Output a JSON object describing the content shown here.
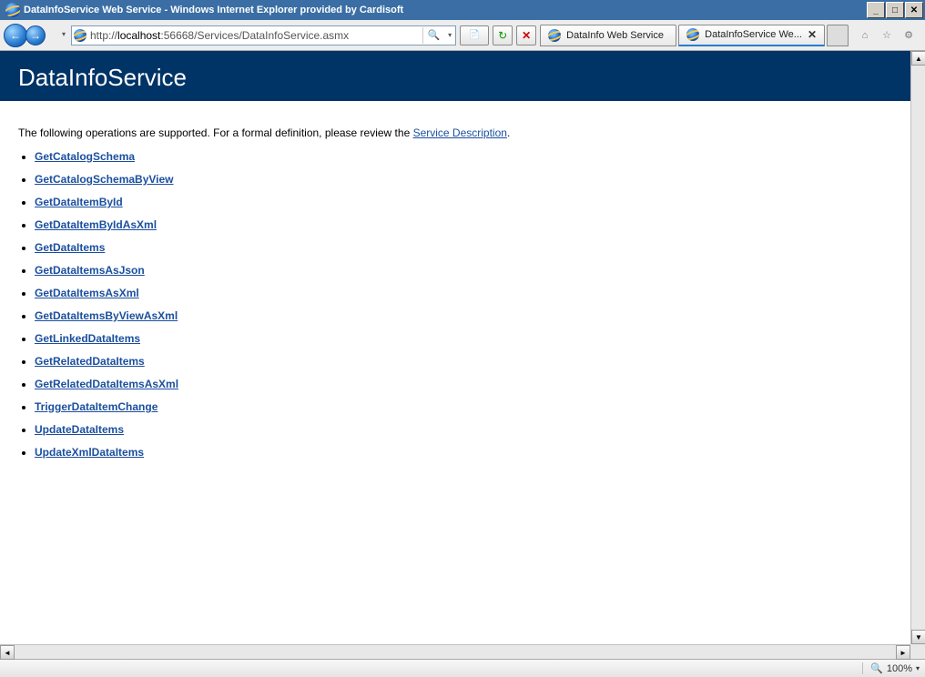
{
  "window": {
    "title": "DataInfoService Web Service - Windows Internet Explorer provided by Cardisoft"
  },
  "address": {
    "prefix": "http://",
    "host": "localhost",
    "port_path": ":56668/Services/DataInfoService.asmx"
  },
  "tabs": [
    {
      "label": "DataInfo Web Service",
      "active": false,
      "closeable": false
    },
    {
      "label": "DataInfoService We...",
      "active": true,
      "closeable": true
    }
  ],
  "page": {
    "heading": "DataInfoService",
    "intro_pre": "The following operations are supported. For a formal definition, please review the ",
    "intro_link": "Service Description",
    "intro_post": ".",
    "operations": [
      "GetCatalogSchema",
      "GetCatalogSchemaByView",
      "GetDataItemById",
      "GetDataItemByIdAsXml",
      "GetDataItems",
      "GetDataItemsAsJson",
      "GetDataItemsAsXml",
      "GetDataItemsByViewAsXml",
      "GetLinkedDataItems",
      "GetRelatedDataItems",
      "GetRelatedDataItemsAsXml",
      "TriggerDataItemChange",
      "UpdateDataItems",
      "UpdateXmlDataItems"
    ]
  },
  "status": {
    "zoom": "100%"
  },
  "glyphs": {
    "min": "_",
    "max": "□",
    "close": "✕",
    "dd": "▾",
    "search": "🔍",
    "refresh": "↻",
    "stop": "✕",
    "home": "⌂",
    "star": "☆",
    "gear": "⚙",
    "tri_l": "◄",
    "tri_r": "►",
    "tri_u": "▲",
    "tri_d": "▼",
    "mag": "🔍",
    "compat": "📄"
  }
}
